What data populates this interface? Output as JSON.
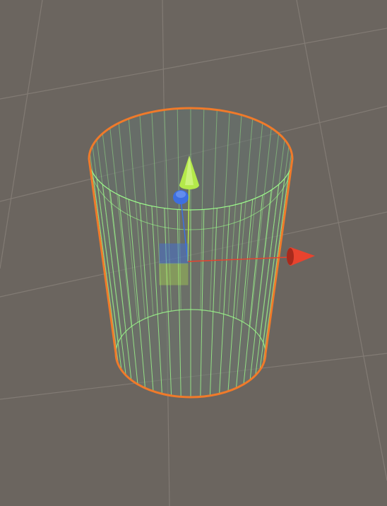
{
  "scene": {
    "background_color": "#6b655f",
    "grid_color": "#8a837c",
    "selection_outline_color": "#f07a2a",
    "collider_wire_color": "#9dfc8c",
    "object": {
      "shape": "cylinder",
      "selected": true,
      "wireframe": true
    },
    "gizmo": {
      "mode": "move",
      "x_axis_color": "#e8432e",
      "y_axis_color": "#b4e94a",
      "z_axis_color": "#3d6fe0",
      "xy_plane_color": "#3d6fe0",
      "xz_plane_color": "#b4e94a",
      "icons": [
        "x-axis-arrow-icon",
        "y-axis-arrow-icon",
        "z-axis-arrow-icon",
        "plane-handle-icon"
      ]
    }
  }
}
